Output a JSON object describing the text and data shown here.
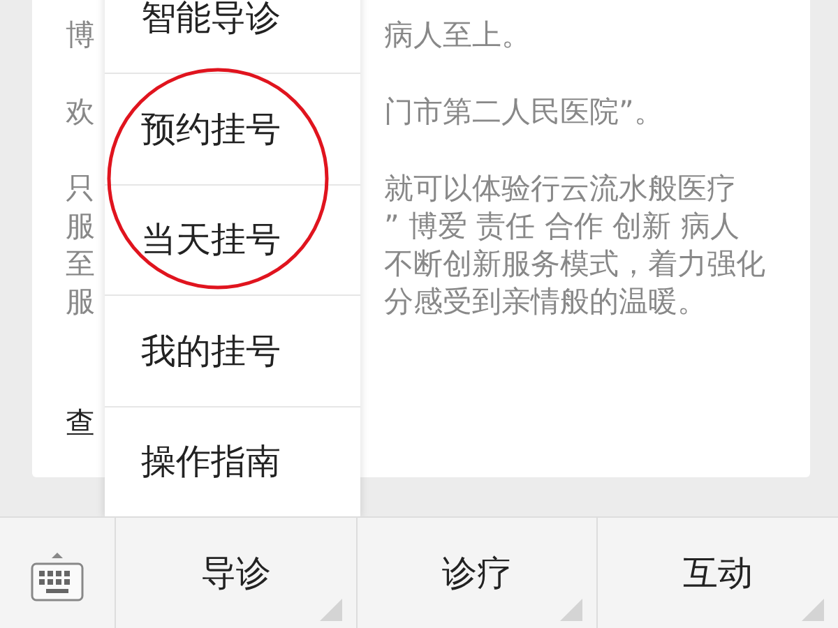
{
  "article": {
    "paragraphs": [
      {
        "lines": [
          {
            "left": "博",
            "right": "病人至上。"
          }
        ]
      },
      {
        "lines": [
          {
            "left": "欢",
            "right": "门市第二人民医院”。"
          }
        ]
      },
      {
        "lines": [
          {
            "left": "只",
            "right": "就可以体验行云流水般医疗"
          },
          {
            "left": "服",
            "right": "” 博爱 责任 合作  创新  病人"
          },
          {
            "left": "至",
            "right": "不断创新服务模式，着力强化"
          },
          {
            "left": "服",
            "right": "分感受到亲情般的温暖。"
          }
        ]
      }
    ],
    "link": "查"
  },
  "popup_menu": {
    "items": [
      "智能导诊",
      "预约挂号",
      "当天挂号",
      "我的挂号",
      "操作指南"
    ]
  },
  "bottom_menu": {
    "items": [
      "导诊",
      "诊疗",
      "互动"
    ]
  }
}
